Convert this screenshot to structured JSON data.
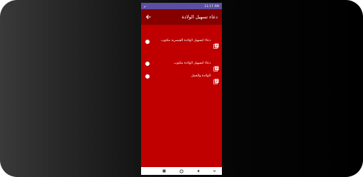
{
  "status_bar": {
    "time": "11:17 AM",
    "signal": "م ·"
  },
  "app_bar": {
    "title": "دعاء تسهيل الولادة",
    "back_icon": "arrow-left-icon"
  },
  "items": [
    {
      "label": "دعاء لتسهيل الولادة القيصرية مكتوب",
      "icon": "library-books-icon"
    },
    {
      "label": "دعاء لتسهيل الولادة مكتوب",
      "icon": "library-books-icon"
    },
    {
      "label": "الولادة والحمل",
      "icon": "library-books-icon"
    }
  ],
  "nav_bar": {
    "recents_icon": "square-icon",
    "home_icon": "circle-icon",
    "back_icon": "triangle-back-icon",
    "down_icon": "chevron-down-icon"
  },
  "colors": {
    "background_red": "#c00000",
    "appbar_dark_red": "#870000",
    "status_purple": "#5b4fa1"
  }
}
